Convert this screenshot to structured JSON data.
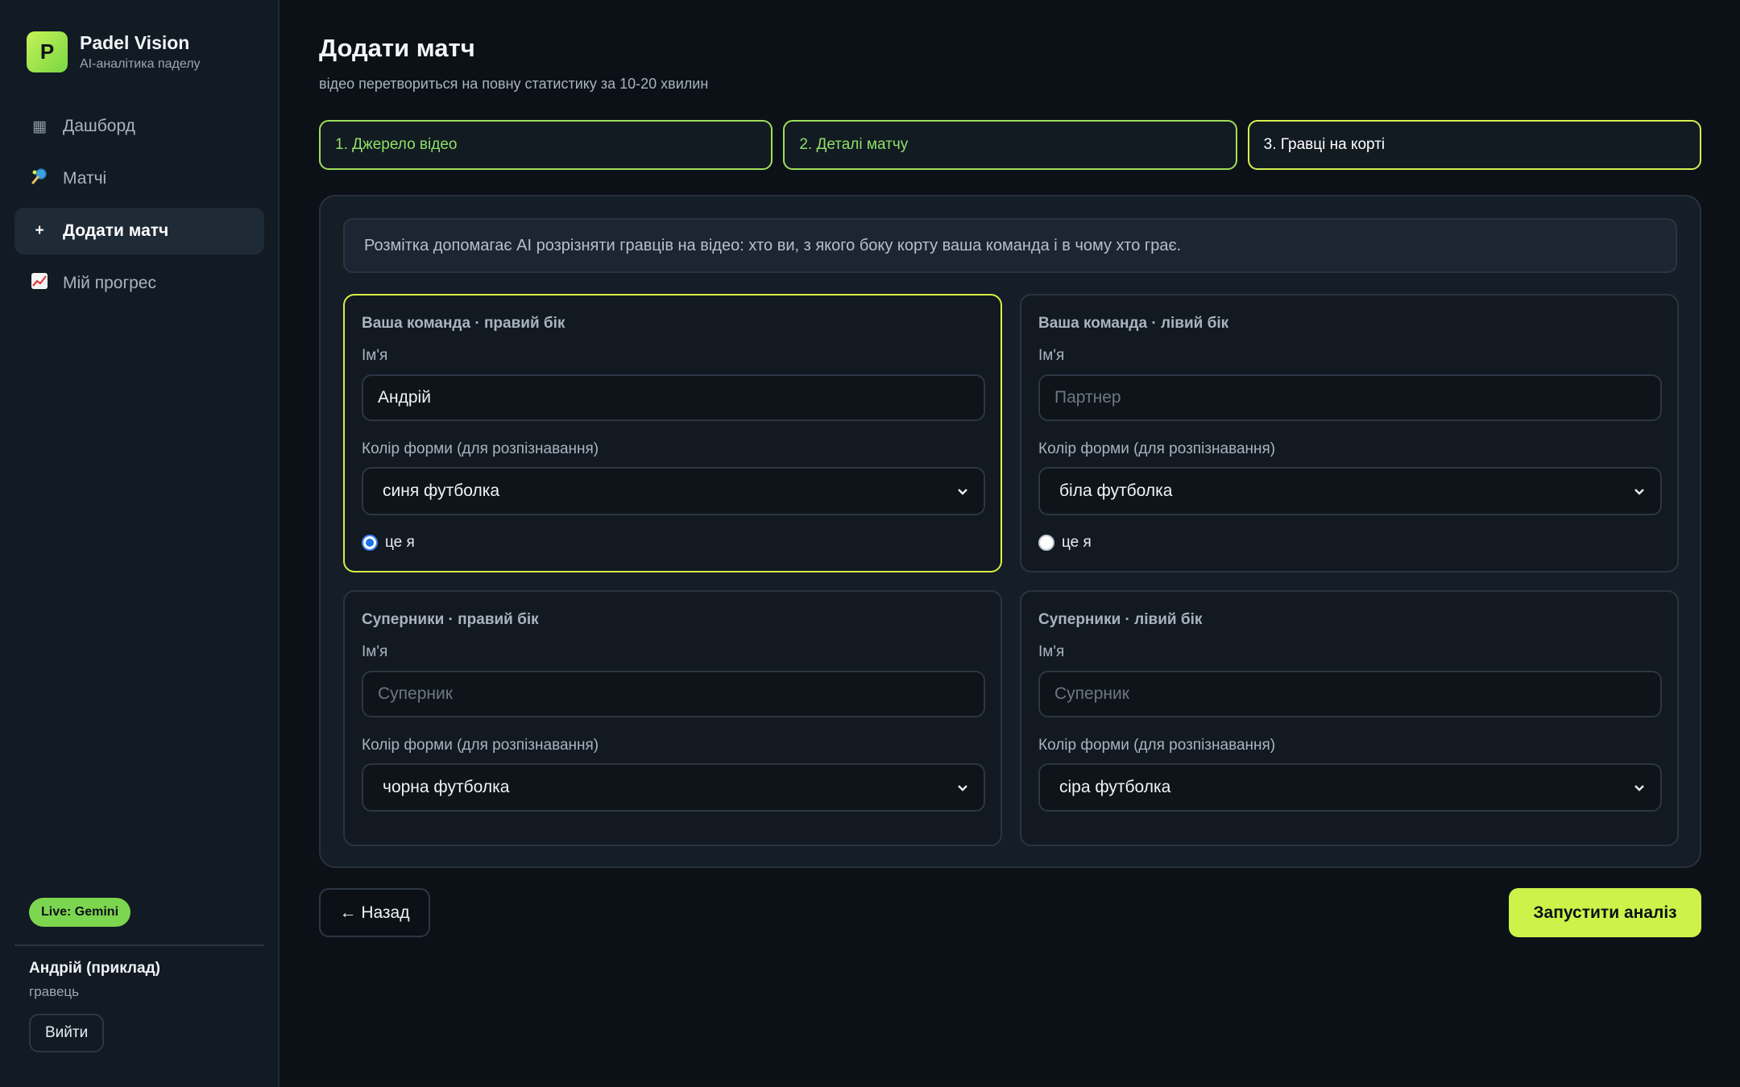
{
  "brand": {
    "logo_letter": "P",
    "name": "Padel Vision",
    "subtitle": "AI-аналітика паделу"
  },
  "nav": {
    "items": [
      {
        "label": "Дашборд",
        "icon": "grid-icon"
      },
      {
        "label": "Матчі",
        "icon": "tennis-racket-icon"
      },
      {
        "label": "Додати матч",
        "icon": "plus-icon",
        "active": true
      },
      {
        "label": "Мій прогрес",
        "icon": "chart-up-icon"
      }
    ]
  },
  "live_badge": "Live: Gemini",
  "user": {
    "name": "Андрій (приклад)",
    "role": "гравець",
    "logout_label": "Вийти"
  },
  "page": {
    "title": "Додати матч",
    "subtitle": "відео перетвориться на повну статистику за 10-20 хвилин"
  },
  "steps": [
    {
      "label": "1. Джерело відео",
      "state": "done"
    },
    {
      "label": "2. Деталі матчу",
      "state": "done"
    },
    {
      "label": "3. Гравці на корті",
      "state": "current"
    }
  ],
  "info_text": "Розмітка допомагає AI розрізняти гравців на відео: хто ви, з якого боку корту ваша команда і в чому хто грає.",
  "labels": {
    "name": "Ім'я",
    "kit_color": "Колір форми (для розпізнавання)",
    "this_is_me": "це я"
  },
  "players": [
    {
      "title": "Ваша команда · правий бік",
      "name_value": "Андрій",
      "name_placeholder": "",
      "color": "синя футболка",
      "me": true,
      "radio": true
    },
    {
      "title": "Ваша команда · лівий бік",
      "name_value": "",
      "name_placeholder": "Партнер",
      "color": "біла футболка",
      "me": false,
      "radio": true
    },
    {
      "title": "Суперники · правий бік",
      "name_value": "",
      "name_placeholder": "Суперник",
      "color": "чорна футболка",
      "me": false,
      "radio": false
    },
    {
      "title": "Суперники · лівий бік",
      "name_value": "",
      "name_placeholder": "Суперник",
      "color": "сіра футболка",
      "me": false,
      "radio": false
    }
  ],
  "actions": {
    "back_label": "← Назад",
    "run_label": "Запустити аналіз"
  },
  "colors": {
    "accent": "#cdf34a",
    "step_done": "#8fe067",
    "live": "#7cd54f"
  }
}
